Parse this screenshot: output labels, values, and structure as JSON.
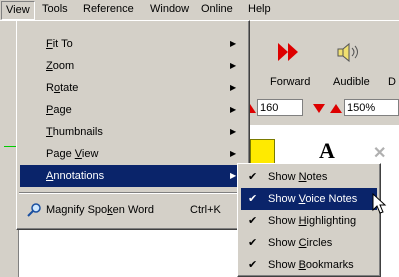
{
  "menubar": {
    "items": [
      "View",
      "Tools",
      "Reference",
      "Window",
      "Online",
      "Help"
    ]
  },
  "toolbar": {
    "partial_label": "d",
    "forward_label": "Forward",
    "audible_label": "Audible",
    "cut_label": "D",
    "page_value": "160",
    "zoom_value": "150%",
    "colors": {
      "arrow_red": "#dd0000",
      "sticky_yellow": "#ffea00"
    }
  },
  "view_menu": {
    "items": [
      {
        "label": "Fit To",
        "accel": "F",
        "submenu": true
      },
      {
        "label": "Zoom",
        "accel": "Z",
        "submenu": true
      },
      {
        "label": "Rotate",
        "accel": "o",
        "submenu": true
      },
      {
        "label": "Page",
        "accel": "P",
        "submenu": true
      },
      {
        "label": "Thumbnails",
        "accel": "T",
        "submenu": true
      },
      {
        "label": "Page View",
        "accel": "V",
        "submenu": true
      },
      {
        "label": "Annotations",
        "accel": "A",
        "submenu": true,
        "highlighted": true
      }
    ],
    "magnify": {
      "label": "Magnify Spoken Word",
      "shortcut": "Ctrl+K",
      "icon": "magnifier-icon"
    }
  },
  "annotations_submenu": {
    "items": [
      {
        "label": "Show Notes",
        "checked": true
      },
      {
        "label": "Show Voice Notes",
        "checked": true,
        "highlighted": true
      },
      {
        "label": "Show Highlighting",
        "checked": true
      },
      {
        "label": "Show Circles",
        "checked": true
      },
      {
        "label": "Show Bookmarks",
        "checked": true
      }
    ]
  }
}
